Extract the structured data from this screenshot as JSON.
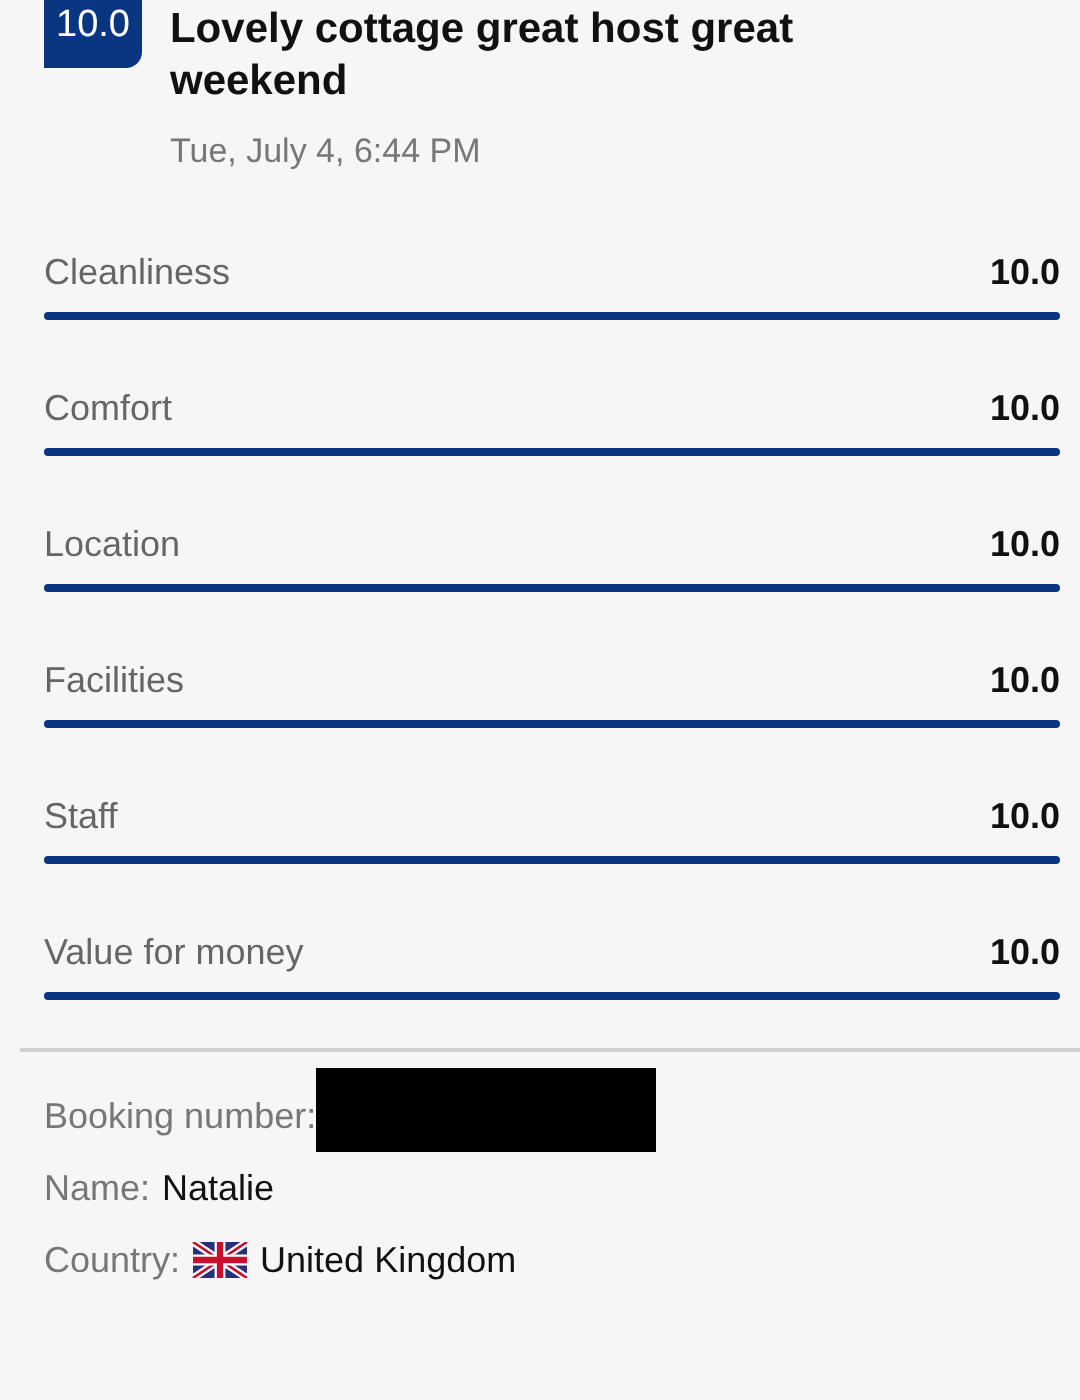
{
  "review": {
    "score": "10.0",
    "title": "Lovely cottage great host great weekend",
    "date": "Tue, July 4, 6:44 PM"
  },
  "ratings": [
    {
      "label": "Cleanliness",
      "value": "10.0",
      "level": 1
    },
    {
      "label": "Comfort",
      "value": "10.0",
      "level": 1
    },
    {
      "label": "Location",
      "value": "10.0",
      "level": 1
    },
    {
      "label": "Facilities",
      "value": "10.0",
      "level": 1
    },
    {
      "label": "Staff",
      "value": "10.0",
      "level": 1
    },
    {
      "label": "Value for money",
      "value": "10.0",
      "level": 1
    }
  ],
  "details": {
    "booking_label": "Booking number:",
    "name_label": "Name:",
    "name": "Natalie",
    "country_label": "Country:",
    "country": "United Kingdom"
  }
}
